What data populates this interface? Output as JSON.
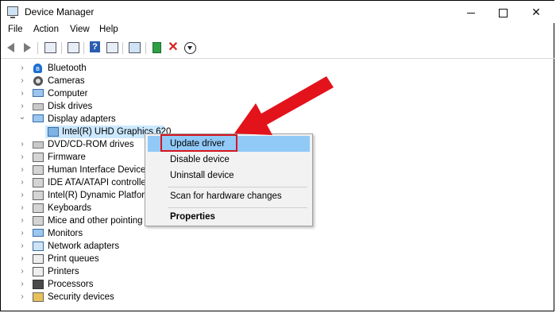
{
  "window": {
    "title": "Device Manager",
    "icon": "device-manager-icon"
  },
  "window_controls": {
    "minimize_icon": "minimize-icon",
    "maximize_icon": "maximize-icon",
    "close_glyph": "✕"
  },
  "menu": {
    "file": "File",
    "action": "Action",
    "view": "View",
    "help": "Help"
  },
  "toolbar": {
    "icons": [
      "back-arrow-icon",
      "forward-arrow-icon",
      "properties-icon",
      "show-hidden-icon",
      "help-icon",
      "resources-icon",
      "scan-hardware-icon",
      "add-driver-icon",
      "uninstall-icon",
      "update-driver-icon"
    ],
    "help_glyph": "?",
    "uninstall_glyph": "✕"
  },
  "tree": {
    "items": [
      {
        "label": "Bluetooth",
        "icon": "bluetooth-icon",
        "expanded": false
      },
      {
        "label": "Cameras",
        "icon": "camera-icon",
        "expanded": false
      },
      {
        "label": "Computer",
        "icon": "computer-icon",
        "expanded": false
      },
      {
        "label": "Disk drives",
        "icon": "disk-drive-icon",
        "expanded": false
      },
      {
        "label": "Display adapters",
        "icon": "display-adapter-icon",
        "expanded": true
      },
      {
        "label": "Intel(R) UHD Graphics 620",
        "icon": "gpu-icon",
        "child": true,
        "selected": true
      },
      {
        "label": "DVD/CD-ROM drives",
        "icon": "dvd-drive-icon",
        "expanded": false
      },
      {
        "label": "Firmware",
        "icon": "firmware-icon",
        "expanded": false
      },
      {
        "label": "Human Interface Devices",
        "icon": "hid-icon",
        "expanded": false
      },
      {
        "label": "IDE ATA/ATAPI controllers",
        "icon": "ide-controller-icon",
        "expanded": false
      },
      {
        "label": "Intel(R) Dynamic Platform",
        "icon": "platform-icon",
        "expanded": false
      },
      {
        "label": "Keyboards",
        "icon": "keyboard-icon",
        "expanded": false
      },
      {
        "label": "Mice and other pointing devices",
        "icon": "mouse-icon",
        "expanded": false
      },
      {
        "label": "Monitors",
        "icon": "monitor-icon",
        "expanded": false
      },
      {
        "label": "Network adapters",
        "icon": "network-adapter-icon",
        "expanded": false
      },
      {
        "label": "Print queues",
        "icon": "printer-icon",
        "expanded": false
      },
      {
        "label": "Printers",
        "icon": "printer-icon",
        "expanded": false
      },
      {
        "label": "Processors",
        "icon": "processor-icon",
        "expanded": false
      },
      {
        "label": "Security devices",
        "icon": "security-device-icon",
        "expanded": false
      }
    ],
    "collapsed_glyph": "›",
    "expanded_glyph": "⌄",
    "bluetooth_glyph": "ʙ"
  },
  "context_menu": {
    "update_driver": "Update driver",
    "disable_device": "Disable device",
    "uninstall_device": "Uninstall device",
    "scan_hardware": "Scan for hardware changes",
    "properties": "Properties"
  },
  "annotation": {
    "color": "#e3131b",
    "arrow_icon": "red-arrow-annotation"
  },
  "colors": {
    "menu_highlight": "#91c9f7",
    "selection": "#cce8ff"
  }
}
